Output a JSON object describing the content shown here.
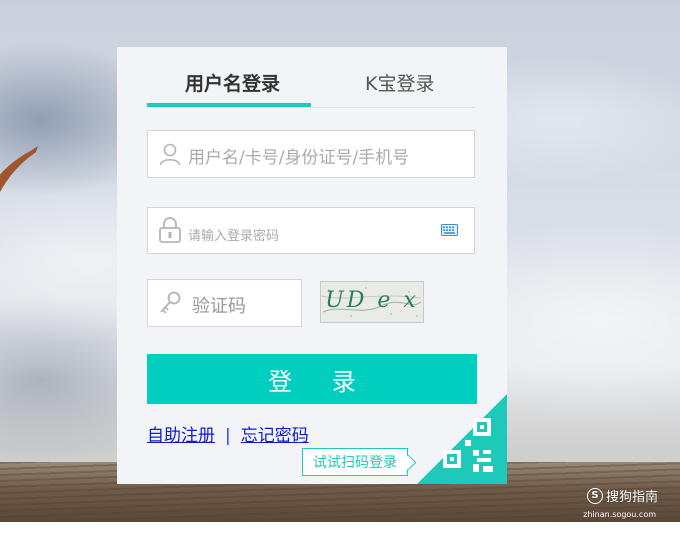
{
  "tabs": {
    "username_login": "用户名登录",
    "kbao_login": "K宝登录"
  },
  "fields": {
    "username_placeholder": "用户名/卡号/身份证号/手机号",
    "password_placeholder": "请输入登录密码",
    "captcha_placeholder": "验证码",
    "captcha_text": "UD e x"
  },
  "actions": {
    "login": "登 录",
    "register": "自助注册",
    "separator": "|",
    "forgot": "忘记密码",
    "qr_tip": "试试扫码登录"
  },
  "watermark": {
    "brand": "搜狗指南",
    "brand_symbol": "S",
    "url": "zhinan.sogou.com"
  },
  "colors": {
    "accent": "#00cfc0",
    "link": "#0d1ccc",
    "panel_bg": "#f3f4f8"
  }
}
